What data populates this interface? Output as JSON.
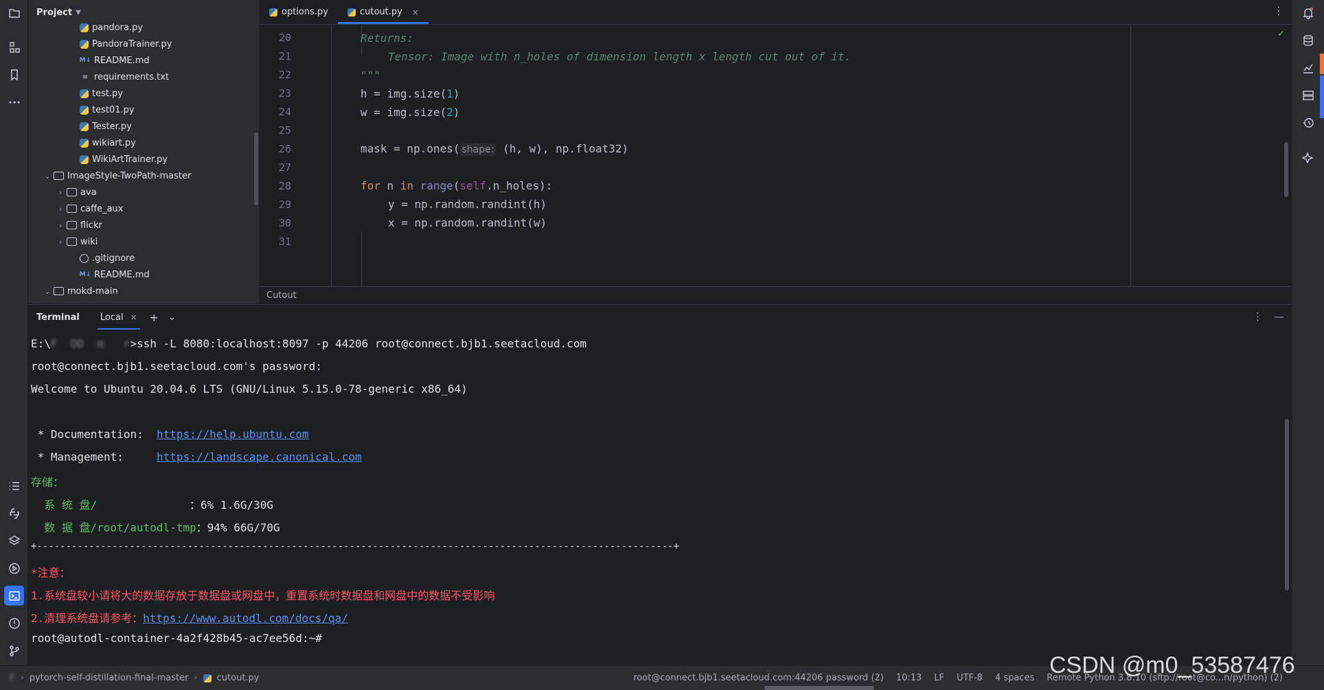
{
  "project": {
    "title": "Project",
    "tree": [
      {
        "label": "pandora.py",
        "icon": "py",
        "indent": 3,
        "arrow": ""
      },
      {
        "label": "PandoraTrainer.py",
        "icon": "py",
        "indent": 3,
        "arrow": ""
      },
      {
        "label": "README.md",
        "icon": "md",
        "indent": 3,
        "arrow": ""
      },
      {
        "label": "requirements.txt",
        "icon": "txt",
        "indent": 3,
        "arrow": ""
      },
      {
        "label": "test.py",
        "icon": "py",
        "indent": 3,
        "arrow": ""
      },
      {
        "label": "test01.py",
        "icon": "py",
        "indent": 3,
        "arrow": ""
      },
      {
        "label": "Tester.py",
        "icon": "py",
        "indent": 3,
        "arrow": ""
      },
      {
        "label": "wikiart.py",
        "icon": "py",
        "indent": 3,
        "arrow": ""
      },
      {
        "label": "WikiArtTrainer.py",
        "icon": "py",
        "indent": 3,
        "arrow": ""
      },
      {
        "label": "ImageStyle-TwoPath-master",
        "icon": "folder",
        "indent": 1,
        "arrow": "expanded"
      },
      {
        "label": "ava",
        "icon": "folder",
        "indent": 2,
        "arrow": "collapsed"
      },
      {
        "label": "caffe_aux",
        "icon": "folder",
        "indent": 2,
        "arrow": "collapsed"
      },
      {
        "label": "flickr",
        "icon": "folder",
        "indent": 2,
        "arrow": "collapsed"
      },
      {
        "label": "wiki",
        "icon": "folder",
        "indent": 2,
        "arrow": "collapsed"
      },
      {
        "label": ".gitignore",
        "icon": "ignore",
        "indent": 3,
        "arrow": ""
      },
      {
        "label": "README.md",
        "icon": "md",
        "indent": 3,
        "arrow": ""
      },
      {
        "label": "mokd-main",
        "icon": "folder",
        "indent": 1,
        "arrow": "expanded"
      }
    ]
  },
  "editor": {
    "tabs": [
      {
        "label": "options.py",
        "active": false
      },
      {
        "label": "cutout.py",
        "active": true
      }
    ],
    "close_glyph": "×",
    "line_numbers": [
      "20",
      "21",
      "22",
      "23",
      "24",
      "25",
      "26",
      "27",
      "28",
      "29",
      "30",
      "31"
    ],
    "code": {
      "l20": "Returns:",
      "l21": "Tensor: Image with n_holes of dimension length x length cut out of it.",
      "l22": "\"\"\"",
      "l23_a": "h = img.size(",
      "l23_b": "1",
      "l23_c": ")",
      "l24_a": "w = img.size(",
      "l24_b": "2",
      "l24_c": ")",
      "l26_a": "mask = np.ones(",
      "l26_hint": "shape:",
      "l26_b": " (h, w), np.float32)",
      "l28_for": "for",
      "l28_a": " n ",
      "l28_in": "in",
      "l28_sp": " ",
      "l28_range": "range",
      "l28_b": "(",
      "l28_self": "self",
      "l28_c": ".n_holes):",
      "l29": "y = np.random.randint(h)",
      "l30": "x = np.random.randint(w)"
    },
    "breadcrumb": "Cutout",
    "check_glyph": "✓"
  },
  "terminal": {
    "title": "Terminal",
    "tab_label": "Local",
    "add_glyph": "+",
    "dropdown_glyph": "⌄",
    "lines": {
      "t1_prefix": "E:\\",
      "t1_blur": "F  OD  m   r",
      "t1_cmd": ">ssh -L 8080:localhost:8097 -p 44206 root@connect.bjb1.seetacloud.com",
      "t2": "root@connect.bjb1.seetacloud.com's password:",
      "t3": "Welcome to Ubuntu 20.04.6 LTS (GNU/Linux 5.15.0-78-generic x86_64)",
      "t5_label": " * Documentation:  ",
      "t5_link": "https://help.ubuntu.com",
      "t6_label": " * Management:     ",
      "t6_link": "https://landscape.canonical.com",
      "t7": "存储：",
      "t8_label": "  系 统 盘/              ",
      "t8_val": "：6% 1.6G/30G",
      "t9_label": "  数 据 盘/root/autodl-tmp",
      "t9_val": "：94% 66G/70G",
      "t10": "+--------------------------------------------------------------------------------------------------------------+",
      "t11": "*注意：",
      "t12": "1.系统盘较小请将大的数据存放于数据盘或网盘中，重置系统时数据盘和网盘中的数据不受影响",
      "t13_a": "2.清理系统盘请参考：",
      "t13_link": "https://www.autodl.com/docs/qa/",
      "t14": "root@autodl-container-4a2f428b45-ac7ee56d:~#"
    }
  },
  "status": {
    "root_blur": "F    ",
    "project_name": "pytorch-self-distillation-final-master",
    "file": "cutout.py",
    "connection": "root@connect.bjb1.seetacloud.com:44206 password (2)",
    "position": "10:13",
    "line_ending": "LF",
    "encoding": "UTF-8",
    "indent": "4 spaces",
    "interpreter": "Remote Python 3.8.10 (sftp://root@co...n/python) (2)"
  },
  "watermark": "CSDN @m0_53587476",
  "colors": {
    "accent": "#3574f0",
    "bg": "#1e1f22",
    "panel": "#2b2d30"
  }
}
